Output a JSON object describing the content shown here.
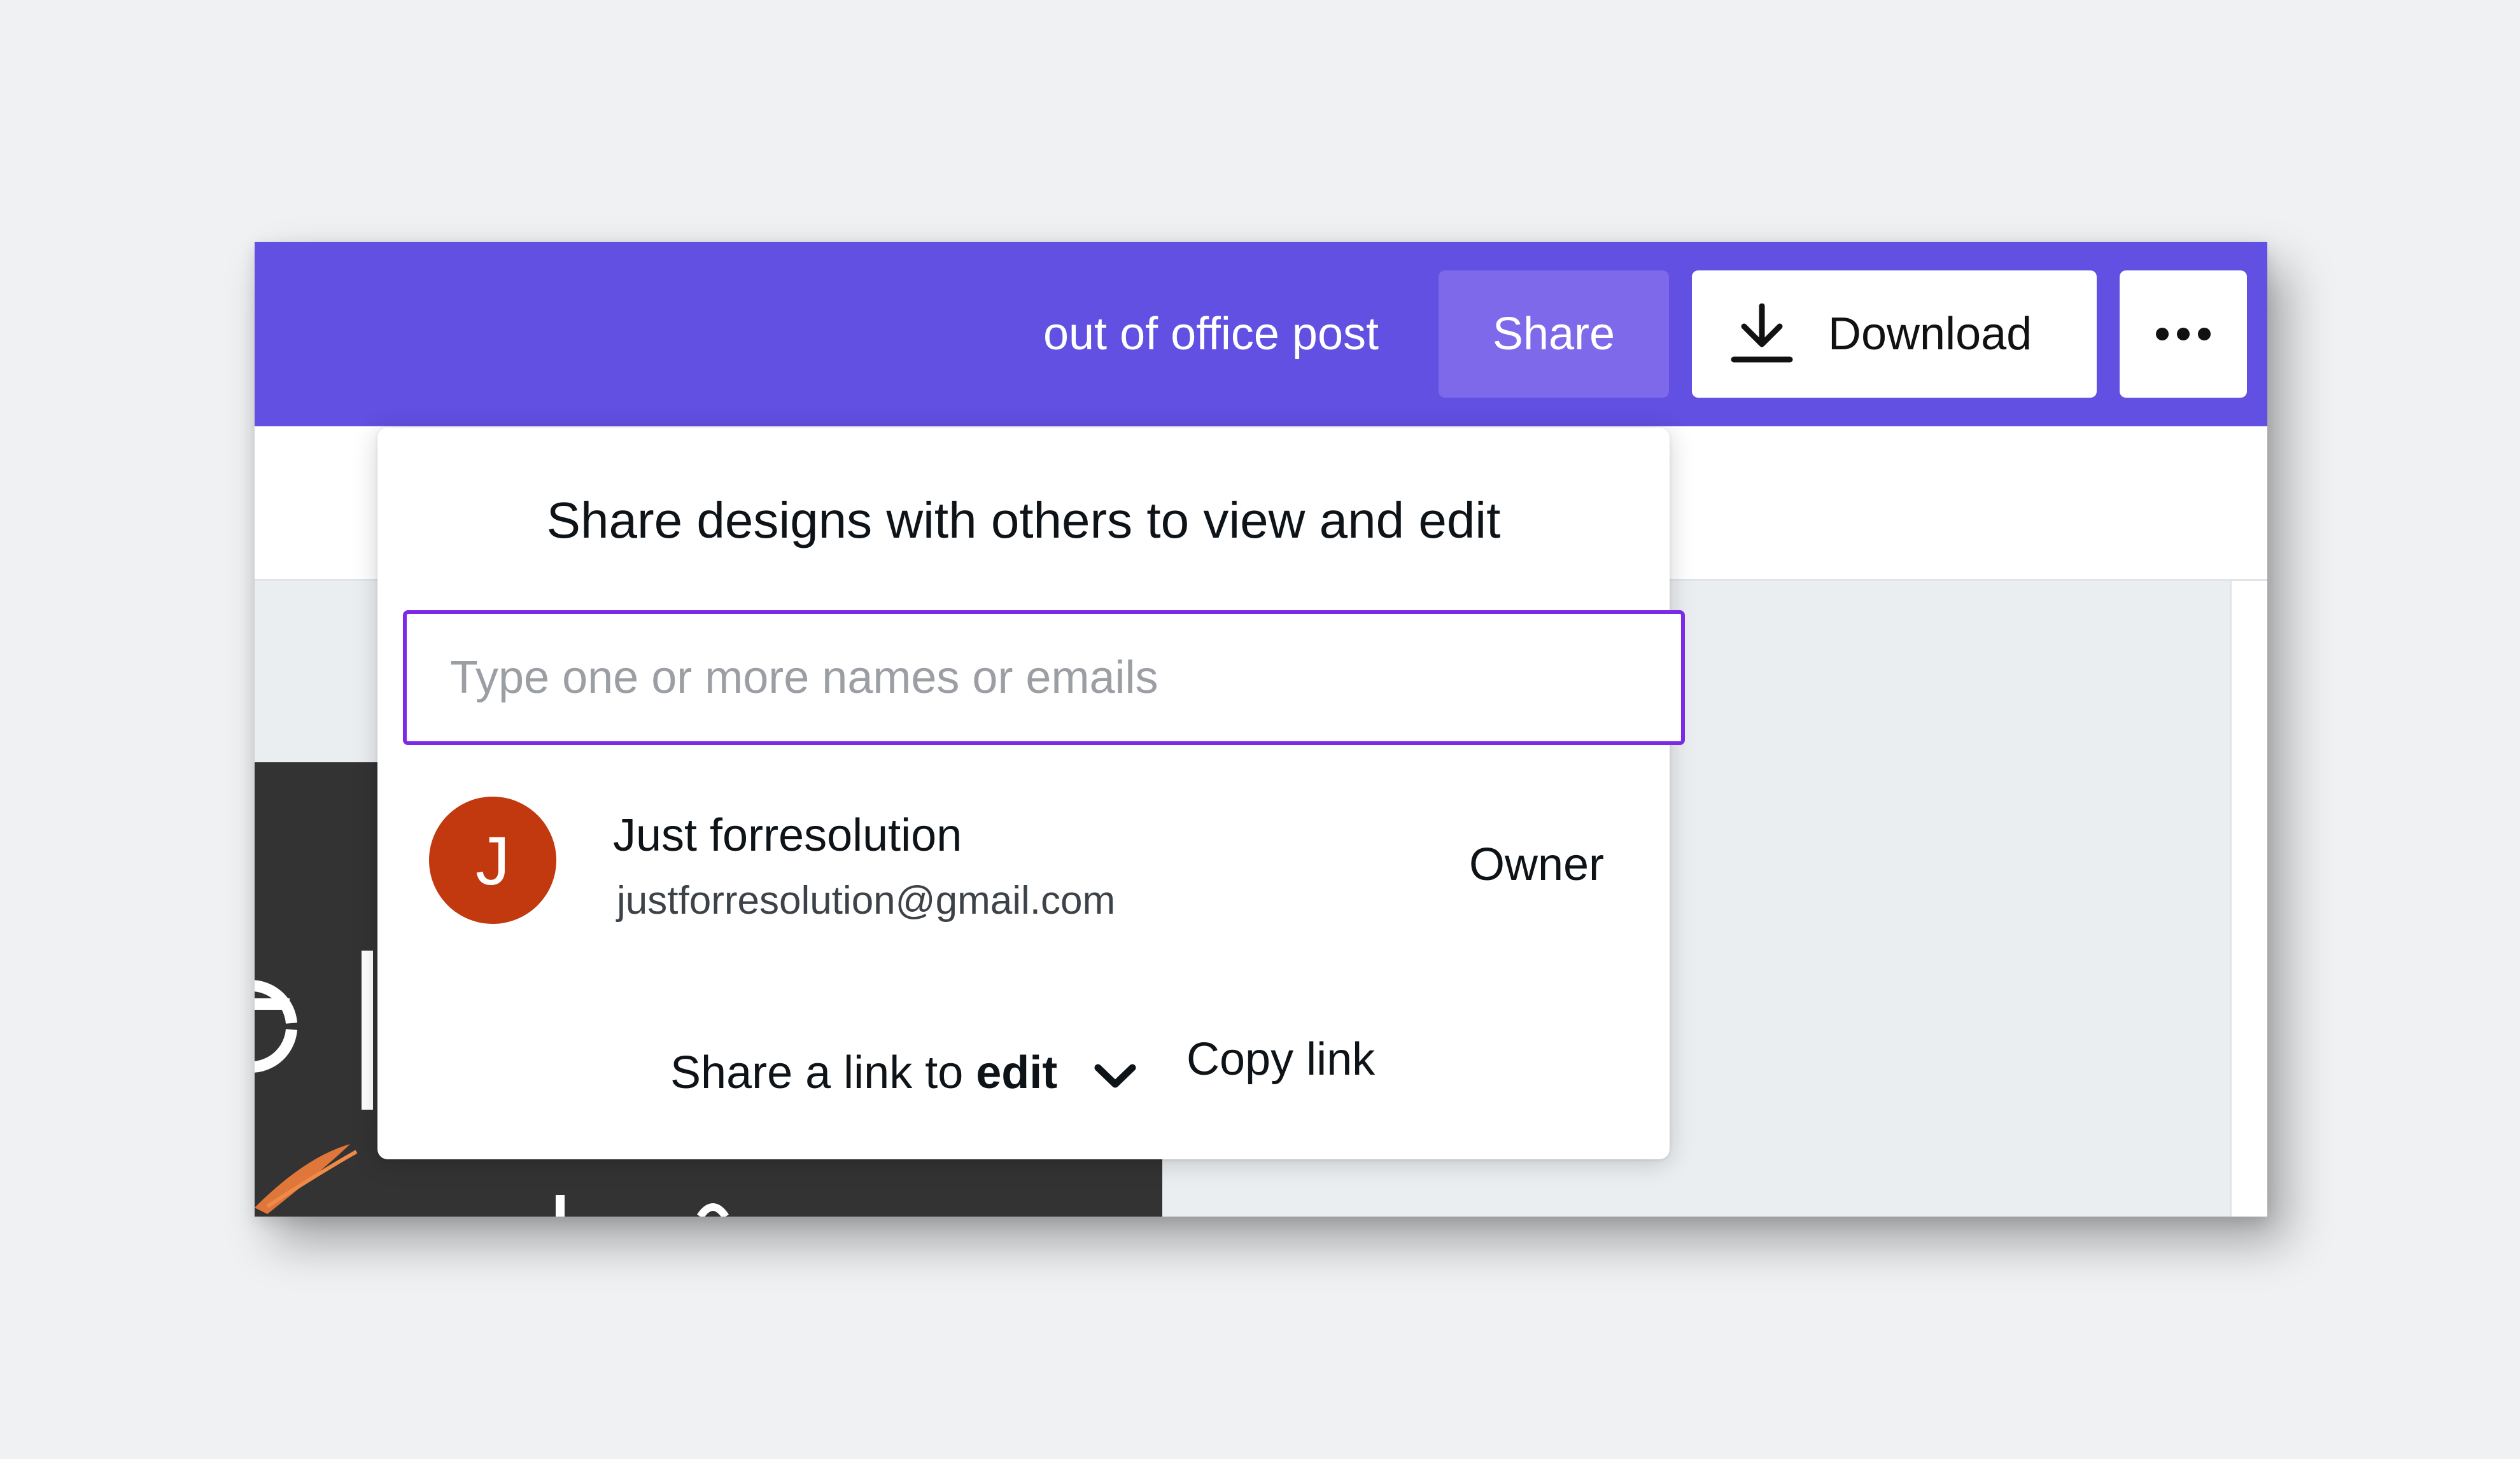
{
  "header": {
    "design_title": "out of office post",
    "share_label": "Share",
    "download_label": "Download",
    "more_icon": "more-horizontal-icon"
  },
  "share_panel": {
    "heading": "Share designs with others to view and edit",
    "people_input": {
      "placeholder": "Type one or more names or emails",
      "value": ""
    },
    "members": [
      {
        "initial": "J",
        "name": "Just forresolution",
        "email": "justforresolution@gmail.com",
        "role": "Owner"
      }
    ],
    "link_access": {
      "prefix": "Share a link to",
      "permission": "edit"
    },
    "copy_link_label": "Copy link"
  },
  "colors": {
    "brand_purple": "#6150e1",
    "share_button": "#7d69ea",
    "input_focus_border": "#7d2ae8",
    "avatar": "#c2380f"
  }
}
